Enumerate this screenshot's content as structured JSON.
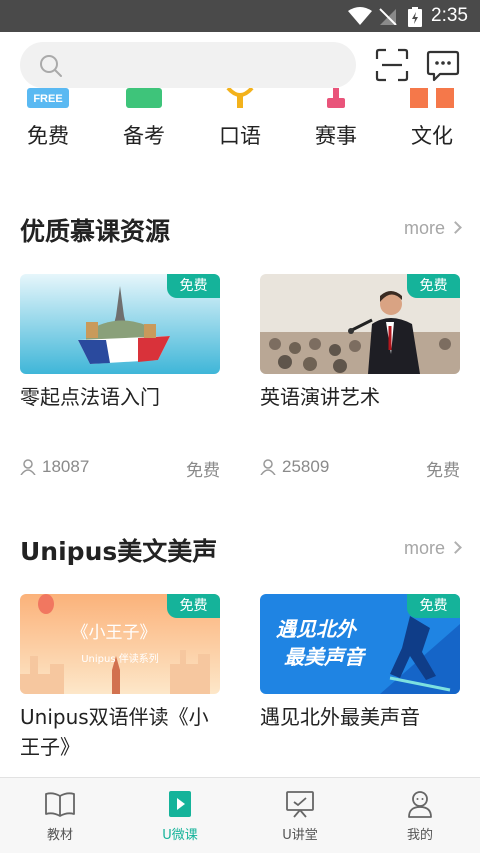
{
  "status_bar": {
    "time": "2:35"
  },
  "search": {
    "placeholder": ""
  },
  "categories": [
    "免费",
    "备考",
    "口语",
    "赛事",
    "文化"
  ],
  "category_icon_label": "FREE",
  "sections": [
    {
      "title": "优质慕课资源",
      "more": "more",
      "cards": [
        {
          "title": "零起点法语入门",
          "badge": "免费",
          "learners": "18087",
          "price": "免费"
        },
        {
          "title": "英语演讲艺术",
          "badge": "免费",
          "learners": "25809",
          "price": "免费"
        }
      ]
    },
    {
      "title": "Unipus美文美声",
      "more": "more",
      "cards": [
        {
          "title": "Unipus双语伴读《小王子》",
          "badge": "免费",
          "art_title": "《小王子》",
          "art_sub": "Unipus 伴读系列"
        },
        {
          "title": "遇见北外最美声音",
          "badge": "免费",
          "art_line1": "遇见北外",
          "art_line2": "最美声音"
        }
      ]
    }
  ],
  "tabs": [
    {
      "label": "教材"
    },
    {
      "label": "U微课"
    },
    {
      "label": "U讲堂"
    },
    {
      "label": "我的"
    }
  ],
  "colors": {
    "accent": "#15b39a",
    "status_bar": "#4a4a4a"
  }
}
